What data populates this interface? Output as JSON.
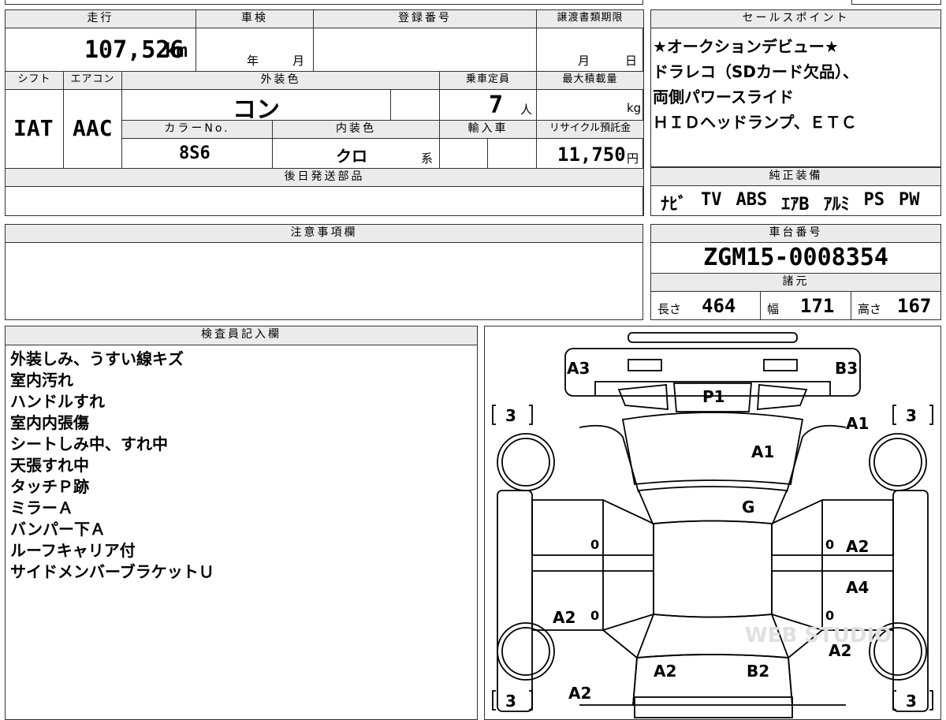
{
  "vehicle": {
    "mileage_label": "走行",
    "mileage_value": "107,526",
    "mileage_unit": "km",
    "inspection_label": "車検",
    "year_unit": "年",
    "month_unit": "月",
    "registration_label": "登録番号",
    "transfer_deadline_label": "譲渡書類期限",
    "day_unit": "日",
    "shift_label": "シフト",
    "shift_value": "IAT",
    "ac_label": "エアコン",
    "ac_value": "AAC",
    "exterior_color_label": "外装色",
    "exterior_color_value": "コン",
    "capacity_label": "乗車定員",
    "capacity_value": "7",
    "capacity_unit": "人",
    "max_load_label": "最大積載量",
    "max_load_unit": "kg",
    "color_no_label": "カラーNo.",
    "color_no_value": "8S6",
    "interior_color_label": "内装色",
    "interior_color_value": "クロ",
    "interior_color_suffix": "系",
    "import_label": "輸入車",
    "recycle_label": "リサイクル預託金",
    "recycle_value": "11,750",
    "recycle_unit": "円",
    "later_parts_label": "後日発送部品"
  },
  "sales_points": {
    "label": "セールスポイント",
    "lines": [
      "★オークションデビュー★",
      "ドラレコ（SDカード欠品）、",
      "両側パワースライド",
      "ＨＩＤヘッドランプ、ＥＴＣ"
    ]
  },
  "equipment": {
    "label": "純正装備",
    "items": [
      "ﾅﾋﾞ",
      "TV",
      "ABS",
      "ｴｱB",
      "ｱﾙﾐ",
      "PS",
      "PW"
    ]
  },
  "caution": {
    "label": "注意事項欄"
  },
  "chassis": {
    "label": "車台番号",
    "value": "ZGM15-0008354",
    "specs_label": "諸元",
    "length_label": "長さ",
    "length_value": "464",
    "width_label": "幅",
    "width_value": "171",
    "height_label": "高さ",
    "height_value": "167"
  },
  "inspector": {
    "label": "検査員記入欄",
    "notes": [
      "外装しみ、うすい線キズ",
      "室内汚れ",
      "ハンドルすれ",
      "室内内張傷",
      "シートしみ中、すれ中",
      "天張すれ中",
      "タッチＰ跡",
      "ミラーＡ",
      "バンパー下Ａ",
      "ルーフキャリア付",
      "サイドメンバーブラケットＵ"
    ]
  },
  "diagram": {
    "tires": [
      "3",
      "3",
      "3",
      "3"
    ],
    "marks": {
      "front_left": "A3",
      "front_right": "B3",
      "front_bumper": "P1",
      "hood": "A1",
      "right_fender": "A1",
      "windshield": "G",
      "left_front_door": "0",
      "right_front_door_num": "0",
      "right_front_door": "A2",
      "right_rear_door": "A4",
      "left_rear_door": "A2",
      "left_rear_door_num": "0",
      "right_rear_door_num": "0",
      "right_rear_fender": "A2",
      "tailgate_left": "A2",
      "tailgate_right": "B2",
      "rear_bumper_left": "A2"
    },
    "watermark": "WEB STUDIO"
  }
}
